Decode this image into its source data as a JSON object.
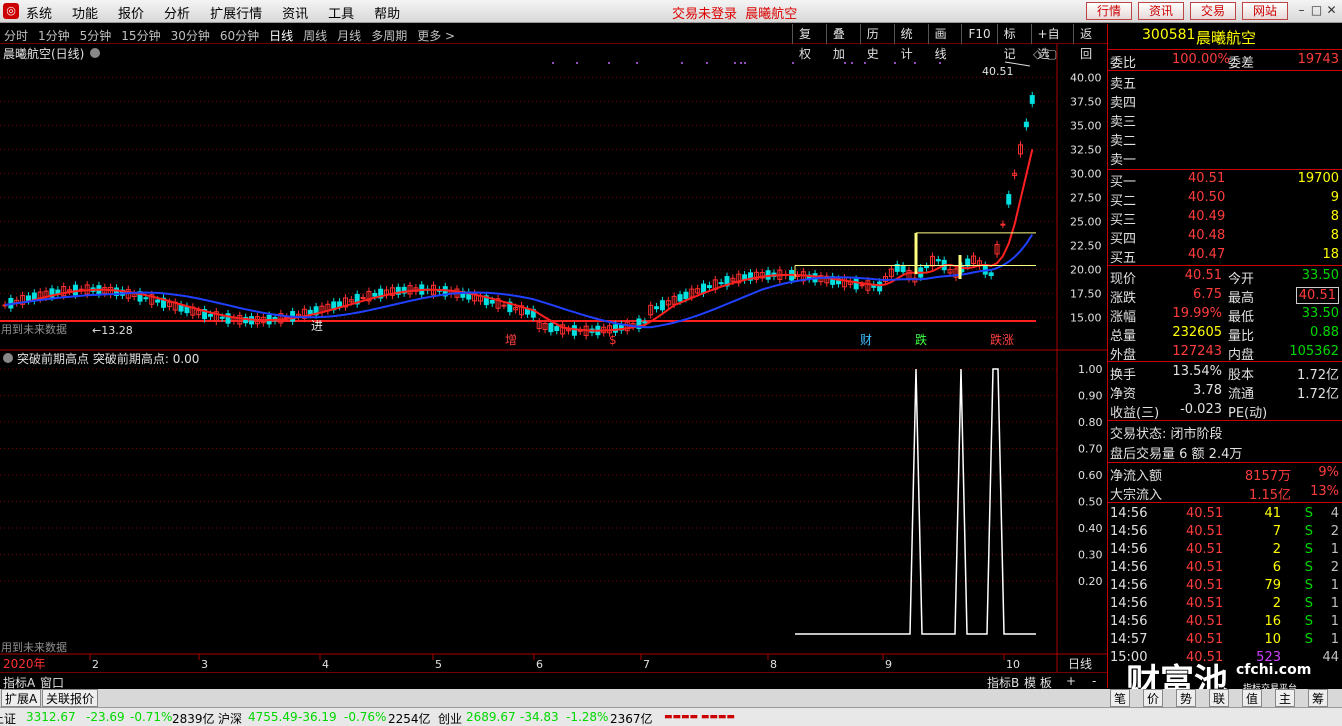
{
  "menubar": {
    "items": [
      "系统",
      "功能",
      "报价",
      "分析",
      "扩展行情",
      "资讯",
      "工具",
      "帮助"
    ],
    "center_status": "交易未登录",
    "center_stock": "晨曦航空",
    "buttons": [
      "行情",
      "资讯",
      "交易",
      "网站"
    ]
  },
  "period_bar": {
    "periods": [
      "分时",
      "1分钟",
      "5分钟",
      "15分钟",
      "30分钟",
      "60分钟",
      "日线",
      "周线",
      "月线",
      "多周期",
      "更多 >"
    ],
    "active": "日线",
    "tools": [
      "复权",
      "叠加",
      "历史",
      "统计",
      "画线",
      "F10",
      "标记",
      "+自选",
      "返回"
    ]
  },
  "main_chart": {
    "header": "晨曦航空(日线)",
    "price_labels": [
      "40.00",
      "37.50",
      "35.00",
      "32.50",
      "30.00",
      "27.50",
      "25.00",
      "22.50",
      "20.00",
      "17.50",
      "15.00"
    ],
    "max_label": "40.51",
    "min_label": "13.28",
    "warn": "用到未来数据",
    "jin": "进",
    "markers": [
      {
        "t": "增",
        "c": "#ff4040"
      },
      {
        "t": "$",
        "c": "#ff3030"
      },
      {
        "t": "财",
        "c": "#40c0ff"
      },
      {
        "t": "跌",
        "c": "#40ff40"
      },
      {
        "t": "跌涨",
        "c": "#ff4040"
      }
    ]
  },
  "indicator": {
    "header": "突破前期高点",
    "value_label": "突破前期高点: 0.00",
    "scale": [
      "1.00",
      "0.90",
      "0.80",
      "0.70",
      "0.60",
      "0.50",
      "0.40",
      "0.30",
      "0.20"
    ],
    "warn": "用到未来数据",
    "spikes": [
      0,
      0,
      0,
      0,
      0,
      1,
      0,
      0,
      0,
      0,
      0,
      1,
      0,
      0,
      0,
      0,
      1,
      1,
      0,
      0,
      0
    ]
  },
  "date_axis": {
    "year": "2020年",
    "months": [
      "2",
      "3",
      "4",
      "5",
      "6",
      "7",
      "8",
      "9",
      "10"
    ],
    "period": "日线"
  },
  "bottom_bar": {
    "left": [
      "指标A",
      "窗口"
    ],
    "right": [
      "指标B",
      "模 板",
      "+",
      "-"
    ]
  },
  "quote": {
    "code": "300581",
    "name": "晨曦航空",
    "weibi": {
      "label": "委比",
      "value": "100.00%",
      "label2": "委差",
      "value2": "19743"
    },
    "sells": [
      {
        "label": "卖五",
        "price": "",
        "vol": ""
      },
      {
        "label": "卖四",
        "price": "",
        "vol": ""
      },
      {
        "label": "卖三",
        "price": "",
        "vol": ""
      },
      {
        "label": "卖二",
        "price": "",
        "vol": ""
      },
      {
        "label": "卖一",
        "price": "",
        "vol": ""
      }
    ],
    "buys": [
      {
        "label": "买一",
        "price": "40.51",
        "vol": "19700"
      },
      {
        "label": "买二",
        "price": "40.50",
        "vol": "9"
      },
      {
        "label": "买三",
        "price": "40.49",
        "vol": "8"
      },
      {
        "label": "买四",
        "price": "40.48",
        "vol": "8"
      },
      {
        "label": "买五",
        "price": "40.47",
        "vol": "18"
      }
    ],
    "stats": [
      {
        "l": "现价",
        "v": "40.51",
        "vc": "up",
        "l2": "今开",
        "v2": "33.50",
        "v2c": "dn"
      },
      {
        "l": "涨跌",
        "v": "6.75",
        "vc": "up",
        "l2": "最高",
        "v2": "40.51",
        "v2c": "upbox"
      },
      {
        "l": "涨幅",
        "v": "19.99%",
        "vc": "up",
        "l2": "最低",
        "v2": "33.50",
        "v2c": "dn"
      },
      {
        "l": "总量",
        "v": "232605",
        "vc": "yl",
        "l2": "量比",
        "v2": "0.88",
        "v2c": "dn"
      },
      {
        "l": "外盘",
        "v": "127243",
        "vc": "up",
        "l2": "内盘",
        "v2": "105362",
        "v2c": "dn"
      }
    ],
    "stats2": [
      {
        "l": "换手",
        "v": "13.54%",
        "l2": "股本",
        "v2": "1.72亿"
      },
      {
        "l": "净资",
        "v": "3.78",
        "l2": "流通",
        "v2": "1.72亿"
      },
      {
        "l": "收益(三)",
        "v": "-0.023",
        "l2": "PE(动)",
        "v2": ""
      }
    ],
    "trade_state": "交易状态: 闭市阶段",
    "after_trade": "盘后交易量 6 额 2.4万",
    "flows": [
      {
        "l": "净流入额",
        "v": "8157万",
        "p": "9%"
      },
      {
        "l": "大宗流入",
        "v": "1.15亿",
        "p": "13%"
      }
    ],
    "ticks": [
      {
        "t": "14:56",
        "p": "40.51",
        "v": "41",
        "s": "S",
        "n": "4"
      },
      {
        "t": "14:56",
        "p": "40.51",
        "v": "7",
        "s": "S",
        "n": "2"
      },
      {
        "t": "14:56",
        "p": "40.51",
        "v": "2",
        "s": "S",
        "n": "1"
      },
      {
        "t": "14:56",
        "p": "40.51",
        "v": "6",
        "s": "S",
        "n": "2"
      },
      {
        "t": "14:56",
        "p": "40.51",
        "v": "79",
        "s": "S",
        "n": "1"
      },
      {
        "t": "14:56",
        "p": "40.51",
        "v": "2",
        "s": "S",
        "n": "1"
      },
      {
        "t": "14:56",
        "p": "40.51",
        "v": "16",
        "s": "S",
        "n": "1"
      },
      {
        "t": "14:57",
        "p": "40.51",
        "v": "10",
        "s": "S",
        "n": "1"
      },
      {
        "t": "15:00",
        "p": "40.51",
        "v": "523",
        "s": "",
        "n": "44"
      }
    ],
    "watermark": "财富池",
    "watermark_url": "cfchi.com",
    "watermark_sub": "指标交易平台"
  },
  "tabs": {
    "left": [
      "扩展A",
      "关联报价"
    ],
    "right": [
      "笔",
      "价",
      "势",
      "联",
      "值",
      "主",
      "筹"
    ]
  },
  "statusbar": [
    {
      "name": "上证",
      "v": "3312.67",
      "c": "-23.69",
      "p": "-0.71%",
      "a": "2839亿"
    },
    {
      "name": "沪深",
      "v": "4755.49",
      "c": "-36.19",
      "p": "-0.76%",
      "a": "2254亿"
    },
    {
      "name": "创业",
      "v": "2689.67",
      "c": "-34.83",
      "p": "-1.28%",
      "a": "2367亿"
    }
  ],
  "colors": {
    "up": "#ff3c3c",
    "down": "#00d8d8",
    "ma1": "#ff2020",
    "ma2": "#2040ff",
    "spike": "#ffffff",
    "box": "#ffff80"
  }
}
